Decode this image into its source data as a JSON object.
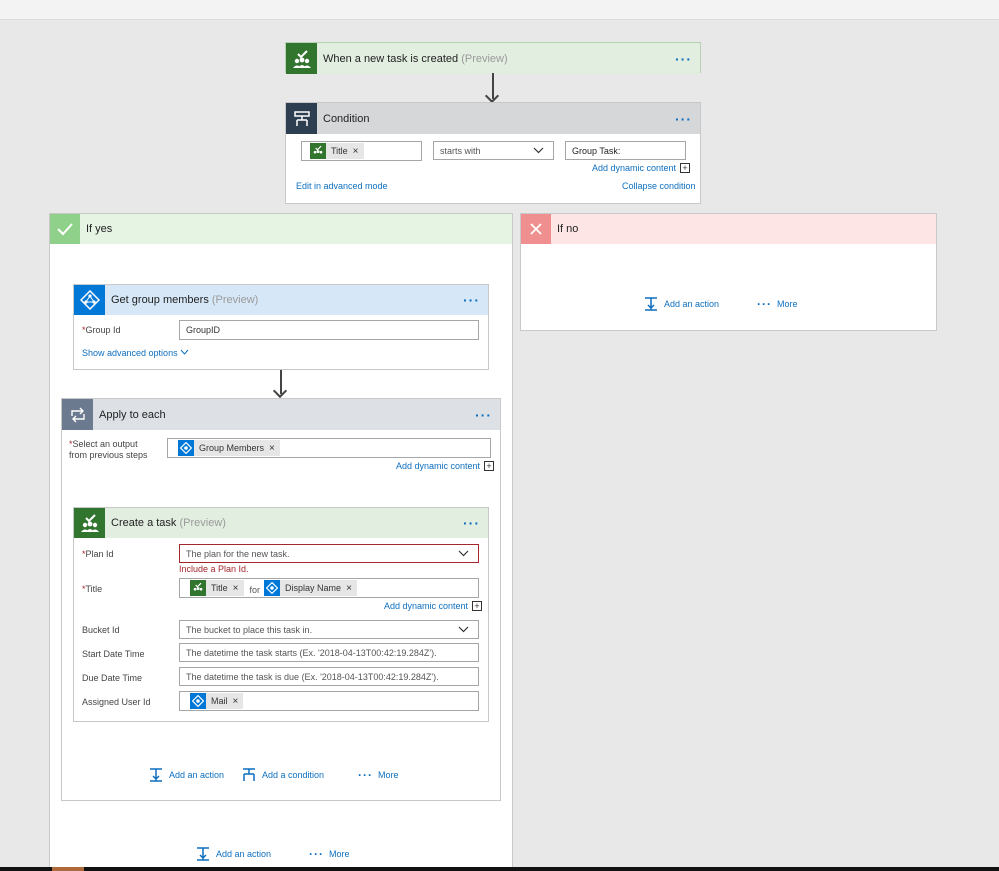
{
  "trigger": {
    "title": "When a new task is created",
    "preview": "(Preview)",
    "menu": "···"
  },
  "condition": {
    "title": "Condition",
    "menu": "···",
    "token": "Title",
    "operator": "starts with",
    "value": "Group Task:",
    "add_dynamic": "Add dynamic content",
    "edit_advanced": "Edit in advanced mode",
    "collapse": "Collapse condition"
  },
  "if_yes": {
    "label": "If yes"
  },
  "if_no": {
    "label": "If no",
    "add_action": "Add an action",
    "more": "More"
  },
  "get_group": {
    "title": "Get group members",
    "preview": "(Preview)",
    "menu": "···",
    "group_id_label": "Group Id",
    "group_id_value": "GroupID",
    "show_advanced": "Show advanced options"
  },
  "apply_each": {
    "title": "Apply to each",
    "menu": "···",
    "select_label_1": "Select an output",
    "select_label_2": "from previous steps",
    "token": "Group Members",
    "add_dynamic": "Add dynamic content"
  },
  "create_task": {
    "title": "Create a task",
    "preview": "(Preview)",
    "menu": "···",
    "plan_label": "Plan Id",
    "plan_placeholder": "The plan for the new task.",
    "plan_error": "Include a Plan Id.",
    "title_label": "Title",
    "title_token_1": "Title",
    "title_for": "for",
    "title_token_2": "Display Name",
    "add_dynamic": "Add dynamic content",
    "bucket_label": "Bucket Id",
    "bucket_placeholder": "The bucket to place this task in.",
    "start_label": "Start Date Time",
    "start_placeholder": "The datetime the task starts (Ex. '2018-04-13T00:42:19.284Z').",
    "due_label": "Due Date Time",
    "due_placeholder": "The datetime the task is due (Ex. '2018-04-13T00:42:19.284Z').",
    "assigned_label": "Assigned User Id",
    "assigned_token": "Mail"
  },
  "inner_footer": {
    "add_action": "Add an action",
    "add_condition": "Add a condition",
    "more": "More"
  },
  "yes_footer": {
    "add_action": "Add an action",
    "more": "More"
  },
  "colors": {
    "planner_green": "#31752f",
    "condition_header": "#2c3e50",
    "azure_ad_blue": "#0078d7",
    "loop_gray": "#6b7a8f",
    "yes_header_bg": "#e9f5e6",
    "no_header_bg": "#fde7e7",
    "link_blue": "#0e6fbf",
    "error_red": "#a4262c"
  }
}
